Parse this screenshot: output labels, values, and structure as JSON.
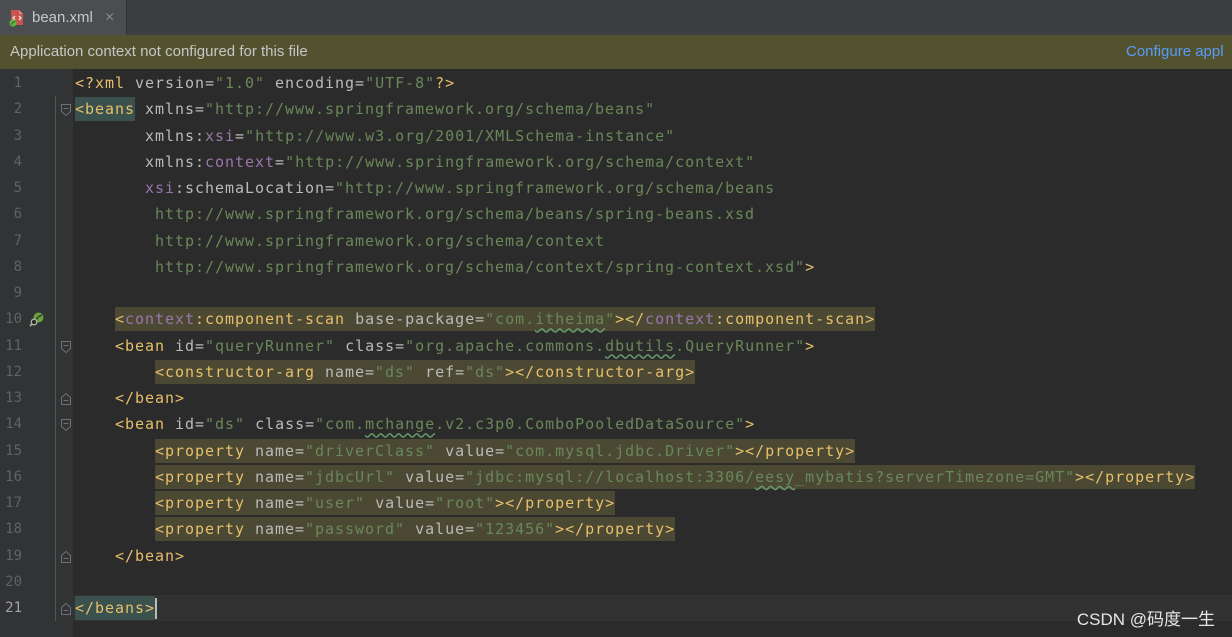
{
  "tab": {
    "title": "bean.xml",
    "close_label": "×",
    "icon": "spring-xml-file-icon"
  },
  "notification": {
    "message": "Application context not configured for this file",
    "action": "Configure appl"
  },
  "colors": {
    "tag": "#e8bf6a",
    "attribute": "#bababa",
    "value": "#6a8759",
    "namespace": "#9876aa",
    "warning_background": "#4b4934",
    "matched_tag_background": "#3b514d",
    "link": "#589df6",
    "notification_background": "#53522f"
  },
  "editor": {
    "lines": [
      {
        "n": "1",
        "tokens": [
          {
            "t": "<?xml",
            "c": "#e8bf6a"
          },
          {
            "t": " version=",
            "c": "#bababa"
          },
          {
            "t": "\"1.0\"",
            "c": "#6a8759"
          },
          {
            "t": " encoding=",
            "c": "#bababa"
          },
          {
            "t": "\"UTF-8\"",
            "c": "#6a8759"
          },
          {
            "t": "?>",
            "c": "#e8bf6a"
          }
        ]
      },
      {
        "n": "2",
        "fold": "fold-open-icon",
        "tokens": [
          {
            "t": "<beans",
            "c": "#e8bf6a",
            "bg": "#3b514d"
          },
          {
            "t": " xmlns=",
            "c": "#bababa"
          },
          {
            "t": "\"http://www.springframework.org/schema/beans\"",
            "c": "#6a8759"
          }
        ]
      },
      {
        "n": "3",
        "indent": "       ",
        "tokens": [
          {
            "t": "xmlns:",
            "c": "#bababa"
          },
          {
            "t": "xsi",
            "c": "#9876aa"
          },
          {
            "t": "=",
            "c": "#bababa"
          },
          {
            "t": "\"http://www.w3.org/2001/XMLSchema-instance\"",
            "c": "#6a8759"
          }
        ]
      },
      {
        "n": "4",
        "indent": "       ",
        "tokens": [
          {
            "t": "xmlns:",
            "c": "#bababa"
          },
          {
            "t": "context",
            "c": "#9876aa"
          },
          {
            "t": "=",
            "c": "#bababa"
          },
          {
            "t": "\"http://www.springframework.org/schema/context\"",
            "c": "#6a8759"
          }
        ]
      },
      {
        "n": "5",
        "indent": "       ",
        "tokens": [
          {
            "t": "xsi",
            "c": "#9876aa"
          },
          {
            "t": ":schemaLocation=",
            "c": "#bababa"
          },
          {
            "t": "\"http://www.springframework.org/schema/beans",
            "c": "#6a8759"
          }
        ]
      },
      {
        "n": "6",
        "indent": "        ",
        "tokens": [
          {
            "t": "http://www.springframework.org/schema/beans/spring-beans.xsd",
            "c": "#6a8759"
          }
        ]
      },
      {
        "n": "7",
        "indent": "        ",
        "tokens": [
          {
            "t": "http://www.springframework.org/schema/context",
            "c": "#6a8759"
          }
        ]
      },
      {
        "n": "8",
        "indent": "        ",
        "tokens": [
          {
            "t": "http://www.springframework.org/schema/context/spring-context.xsd\"",
            "c": "#6a8759"
          },
          {
            "t": ">",
            "c": "#e8bf6a"
          }
        ]
      },
      {
        "n": "9",
        "tokens": []
      },
      {
        "n": "10",
        "gutter_icon": "spring-bean-navigation-icon",
        "indent": "    ",
        "hl": "#4b4934",
        "tokens": [
          {
            "t": "<",
            "c": "#e8bf6a"
          },
          {
            "t": "context",
            "c": "#9876aa"
          },
          {
            "t": ":component-scan",
            "c": "#e8bf6a"
          },
          {
            "t": " base-package=",
            "c": "#bababa"
          },
          {
            "t": "\"com.",
            "c": "#6a8759"
          },
          {
            "t": "itheima",
            "c": "#6a8759",
            "wavy": true
          },
          {
            "t": "\"",
            "c": "#6a8759"
          },
          {
            "t": "></",
            "c": "#e8bf6a"
          },
          {
            "t": "context",
            "c": "#9876aa"
          },
          {
            "t": ":component-scan>",
            "c": "#e8bf6a"
          }
        ]
      },
      {
        "n": "11",
        "fold": "fold-open-icon",
        "indent": "    ",
        "tokens": [
          {
            "t": "<bean",
            "c": "#e8bf6a"
          },
          {
            "t": " id=",
            "c": "#bababa"
          },
          {
            "t": "\"queryRunner\"",
            "c": "#6a8759"
          },
          {
            "t": " class=",
            "c": "#bababa"
          },
          {
            "t": "\"org.apache.commons.",
            "c": "#6a8759"
          },
          {
            "t": "dbutils",
            "c": "#6a8759",
            "wavy": true
          },
          {
            "t": ".QueryRunner\"",
            "c": "#6a8759"
          },
          {
            "t": ">",
            "c": "#e8bf6a"
          }
        ]
      },
      {
        "n": "12",
        "indent": "        ",
        "hl": "#4b4934",
        "tokens": [
          {
            "t": "<constructor-arg",
            "c": "#e8bf6a"
          },
          {
            "t": " name=",
            "c": "#bababa"
          },
          {
            "t": "\"ds\"",
            "c": "#6a8759"
          },
          {
            "t": " ref=",
            "c": "#bababa"
          },
          {
            "t": "\"ds\"",
            "c": "#6a8759"
          },
          {
            "t": "></constructor-arg>",
            "c": "#e8bf6a"
          }
        ]
      },
      {
        "n": "13",
        "fold": "fold-close-icon",
        "indent": "    ",
        "tokens": [
          {
            "t": "</bean>",
            "c": "#e8bf6a"
          }
        ]
      },
      {
        "n": "14",
        "fold": "fold-open-icon",
        "indent": "    ",
        "tokens": [
          {
            "t": "<bean",
            "c": "#e8bf6a"
          },
          {
            "t": " id=",
            "c": "#bababa"
          },
          {
            "t": "\"ds\"",
            "c": "#6a8759"
          },
          {
            "t": " class=",
            "c": "#bababa"
          },
          {
            "t": "\"com.",
            "c": "#6a8759"
          },
          {
            "t": "mchange",
            "c": "#6a8759",
            "wavy": true
          },
          {
            "t": ".v2.c3p0.ComboPooledDataSource\"",
            "c": "#6a8759"
          },
          {
            "t": ">",
            "c": "#e8bf6a"
          }
        ]
      },
      {
        "n": "15",
        "indent": "        ",
        "hl": "#4b4934",
        "tokens": [
          {
            "t": "<property",
            "c": "#e8bf6a"
          },
          {
            "t": " name=",
            "c": "#bababa"
          },
          {
            "t": "\"driverClass\"",
            "c": "#6a8759"
          },
          {
            "t": " value=",
            "c": "#bababa"
          },
          {
            "t": "\"com.mysql.jdbc.Driver\"",
            "c": "#6a8759"
          },
          {
            "t": "></property>",
            "c": "#e8bf6a"
          }
        ]
      },
      {
        "n": "16",
        "indent": "        ",
        "hl": "#4b4934",
        "tokens": [
          {
            "t": "<property",
            "c": "#e8bf6a"
          },
          {
            "t": " name=",
            "c": "#bababa"
          },
          {
            "t": "\"jdbcUrl\"",
            "c": "#6a8759"
          },
          {
            "t": " value=",
            "c": "#bababa"
          },
          {
            "t": "\"jdbc:mysql://localhost:3306/",
            "c": "#6a8759"
          },
          {
            "t": "eesy",
            "c": "#6a8759",
            "wavy": true
          },
          {
            "t": "_mybatis?serverTimezone=GMT\"",
            "c": "#6a8759"
          },
          {
            "t": "></property>",
            "c": "#e8bf6a"
          }
        ]
      },
      {
        "n": "17",
        "indent": "        ",
        "hl": "#4b4934",
        "tokens": [
          {
            "t": "<property",
            "c": "#e8bf6a"
          },
          {
            "t": " name=",
            "c": "#bababa"
          },
          {
            "t": "\"user\"",
            "c": "#6a8759"
          },
          {
            "t": " value=",
            "c": "#bababa"
          },
          {
            "t": "\"root\"",
            "c": "#6a8759"
          },
          {
            "t": "></property>",
            "c": "#e8bf6a"
          }
        ]
      },
      {
        "n": "18",
        "indent": "        ",
        "hl": "#4b4934",
        "tokens": [
          {
            "t": "<property",
            "c": "#e8bf6a"
          },
          {
            "t": " name=",
            "c": "#bababa"
          },
          {
            "t": "\"password\"",
            "c": "#6a8759"
          },
          {
            "t": " value=",
            "c": "#bababa"
          },
          {
            "t": "\"123456\"",
            "c": "#6a8759"
          },
          {
            "t": "></property>",
            "c": "#e8bf6a"
          }
        ]
      },
      {
        "n": "19",
        "fold": "fold-close-icon",
        "indent": "    ",
        "tokens": [
          {
            "t": "</bean>",
            "c": "#e8bf6a"
          }
        ]
      },
      {
        "n": "20",
        "tokens": []
      },
      {
        "n": "21",
        "fold": "fold-close-icon",
        "current": true,
        "caret": true,
        "tokens": [
          {
            "t": "</beans>",
            "c": "#e8bf6a",
            "bg": "#3b514d"
          }
        ]
      }
    ]
  },
  "watermark": "CSDN @码度一生"
}
